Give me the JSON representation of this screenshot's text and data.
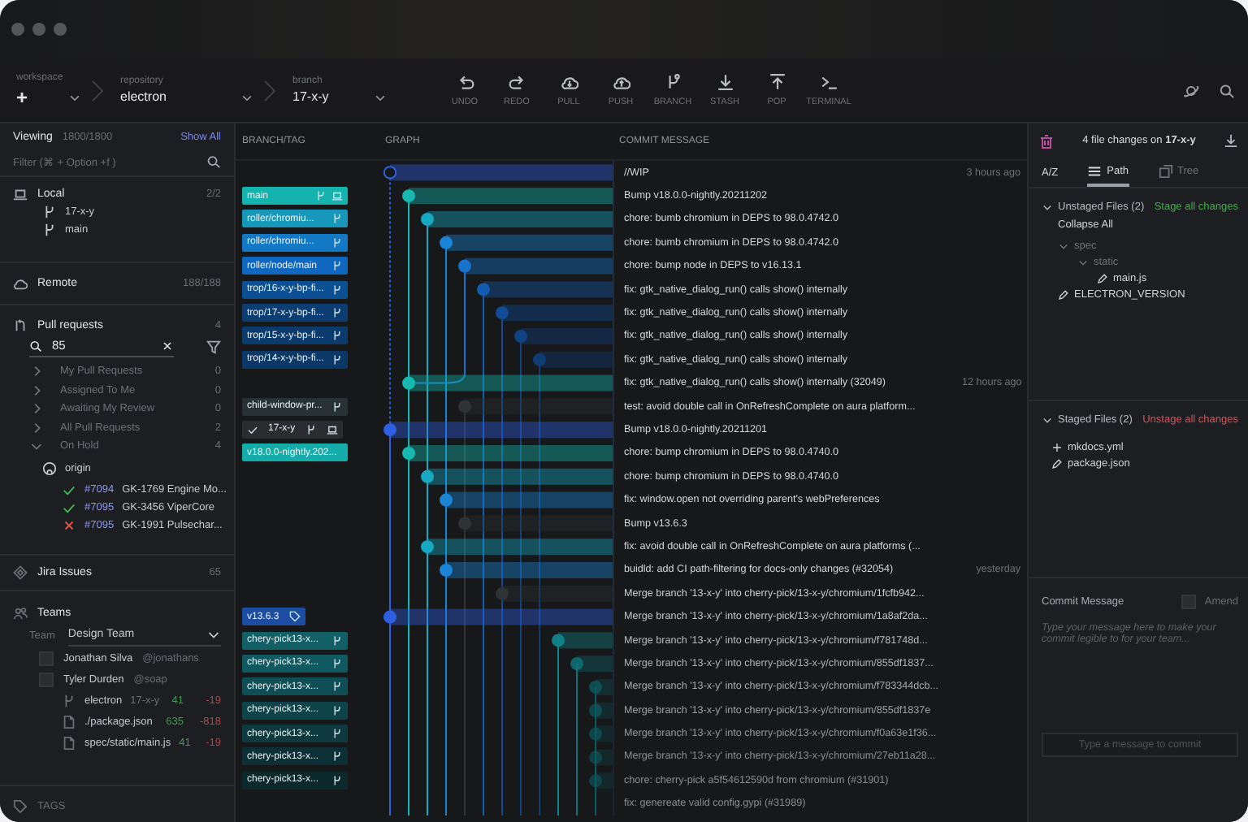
{
  "toolbar": {
    "workspace": {
      "label": "workspace",
      "value": "+"
    },
    "repository": {
      "label": "repository",
      "value": "electron"
    },
    "branch": {
      "label": "branch",
      "value": "17-x-y"
    },
    "actions": [
      {
        "label": "UNDO",
        "kind": "undo"
      },
      {
        "label": "REDO",
        "kind": "redo"
      },
      {
        "label": "PULL",
        "kind": "pull"
      },
      {
        "label": "PUSH",
        "kind": "push"
      },
      {
        "label": "BRANCH",
        "kind": "branch"
      },
      {
        "label": "STASH",
        "kind": "stash"
      },
      {
        "label": "POP",
        "kind": "pop"
      },
      {
        "label": "TERMINAL",
        "kind": "terminal"
      }
    ]
  },
  "sidebar": {
    "viewing": {
      "label": "Viewing",
      "count": "1800/1800",
      "action": "Show All"
    },
    "filter": {
      "placeholder": "Filter (⌘ + Option +f )"
    },
    "local": {
      "title": "Local",
      "count": "2/2",
      "branches": [
        "17-x-y",
        "main"
      ]
    },
    "remote": {
      "title": "Remote",
      "count": "188/188"
    },
    "pull_requests": {
      "title": "Pull requests",
      "count": "4",
      "search": {
        "value": "85"
      },
      "groups": [
        {
          "label": "My Pull Requests",
          "count": "0",
          "expanded": false
        },
        {
          "label": "Assigned To Me",
          "count": "0",
          "expanded": false
        },
        {
          "label": "Awaiting My Review",
          "count": "0",
          "expanded": false
        },
        {
          "label": "All Pull Requests",
          "count": "2",
          "expanded": false
        },
        {
          "label": "On Hold",
          "count": "4",
          "expanded": true
        }
      ],
      "remote": "origin",
      "items": [
        {
          "number": "#7094",
          "title": "GK-1769 Engine Mo...",
          "kind": "passed"
        },
        {
          "number": "#7095",
          "title": "GK-3456 ViperCore",
          "kind": "passed"
        },
        {
          "number": "#7095",
          "title": "GK-1991 Pulsechar...",
          "kind": "failed"
        }
      ]
    },
    "jira": {
      "title": "Jira Issues",
      "count": "65"
    },
    "teams": {
      "title": "Teams",
      "team_label": "Team",
      "team": "Design Team",
      "members": [
        {
          "name": "Jonathan Silva",
          "handle": "@jonathans",
          "checked": false
        },
        {
          "name": "Tyler Durden",
          "handle": "@soap",
          "checked": false
        }
      ],
      "files": [
        {
          "kind": "branch",
          "name": "electron",
          "branch": "17-x-y",
          "added": "41",
          "removed": "-19"
        },
        {
          "kind": "file",
          "name": "./package.json",
          "added": "635",
          "removed": "-818"
        },
        {
          "kind": "file",
          "name": "spec/static/main.js",
          "added": "41",
          "removed": "-19"
        }
      ]
    },
    "tags": {
      "title": "TAGS"
    }
  },
  "graph": {
    "columns": [
      "BRANCH/TAG",
      "GRAPH",
      "COMMIT MESSAGE"
    ],
    "rows": [
      {
        "message": "//WIP",
        "time": "3 hours ago"
      },
      {
        "message": "Bump v18.0.0-nightly.20211202",
        "ref": {
          "name": "main",
          "kind": "local-branch",
          "color": "#14b3ae"
        }
      },
      {
        "message": "chore: bumb chromium in DEPS to 98.0.4742.0",
        "ref": {
          "name": "roller/chromiu...",
          "kind": "branch",
          "color": "#1797b9"
        }
      },
      {
        "message": "chore: bumb chromium in DEPS to 98.0.4742.0",
        "ref": {
          "name": "roller/chromiu...",
          "kind": "branch",
          "color": "#1379c5"
        }
      },
      {
        "message": "chore: bump node in DEPS to v16.13.1",
        "ref": {
          "name": "roller/node/main",
          "kind": "branch",
          "color": "#0f67c0"
        }
      },
      {
        "message": "fix: gtk_native_dialog_run() calls show() internally",
        "ref": {
          "name": "trop/16-x-y-bp-fi...",
          "kind": "branch",
          "color": "#0c4f92"
        }
      },
      {
        "message": "fix: gtk_native_dialog_run() calls show() internally",
        "ref": {
          "name": "trop/17-x-y-bp-fi...",
          "kind": "branch",
          "color": "#0b3c72"
        }
      },
      {
        "message": "fix: gtk_native_dialog_run() calls show() internally",
        "ref": {
          "name": "trop/15-x-y-bp-fi...",
          "kind": "branch",
          "color": "#0b3a6c"
        }
      },
      {
        "message": "fix: gtk_native_dialog_run() calls show() internally",
        "ref": {
          "name": "trop/14-x-y-bp-fi...",
          "kind": "branch",
          "color": "#0b3866"
        }
      },
      {
        "message": "fix: gtk_native_dialog_run() calls show() internally (32049)",
        "time": "12 hours ago"
      },
      {
        "message": "test: avoid double call in OnRefreshComplete on aura platform...",
        "ref": {
          "name": "child-window-pr...",
          "kind": "branch",
          "color": "#283134"
        }
      },
      {
        "message": "Bump v18.0.0-nightly.20211201",
        "ref": {
          "name": "17-x-y",
          "kind": "head",
          "color": "#2a2c30"
        }
      },
      {
        "message": "chore: bump chromium in DEPS to 98.0.4740.0",
        "ref": {
          "name": "v18.0.0-nightly.202...",
          "kind": "plain",
          "color": "#14ada9"
        }
      },
      {
        "message": "chore: bump chromium in DEPS to 98.0.4740.0"
      },
      {
        "message": "fix: window.open not overriding parent's webPreferences"
      },
      {
        "message": "Bump v13.6.3"
      },
      {
        "message": "fix: avoid double call in OnRefreshComplete on aura platforms (..."
      },
      {
        "message": "buidld: add CI path-filtering for docs-only changes (#32054)",
        "time": "yesterday"
      },
      {
        "message": "Merge branch '13-x-y' into cherry-pick/13-x-y/chromium/1fcfb942..."
      },
      {
        "message": "Merge branch '13-x-y' into cherry-pick/13-x-y/chromium/1a8af2da...",
        "ref": {
          "name": "v13.6.3",
          "kind": "tag",
          "color": "#1c4da3"
        }
      },
      {
        "message": "Merge branch '13-x-y' into cherry-pick/13-x-y/chromium/f781748d...",
        "ref": {
          "name": "chery-pick13-x...",
          "kind": "branch",
          "color": "#125f66"
        }
      },
      {
        "message": "Merge branch '13-x-y' into cherry-pick/13-x-y/chromium/855df1837...",
        "ref": {
          "name": "chery-pick13-x...",
          "kind": "branch",
          "color": "#115960"
        }
      },
      {
        "message": "Merge branch '13-x-y' into cherry-pick/13-x-y/chromium/f783344dcb...",
        "ref": {
          "name": "chery-pick13-x...",
          "kind": "branch",
          "color": "#0f4e55"
        }
      },
      {
        "message": "Merge branch '13-x-y' into cherry-pick/13-x-y/chromium/855df1837e",
        "ref": {
          "name": "chery-pick13-x...",
          "kind": "branch",
          "color": "#0e434a"
        }
      },
      {
        "message": "Merge branch '13-x-y' into cherry-pick/13-x-y/chromium/f0a63e1f36...",
        "ref": {
          "name": "chery-pick13-x...",
          "kind": "branch",
          "color": "#0d393f"
        }
      },
      {
        "message": "Merge branch '13-x-y' into cherry-pick/13-x-y/chromium/27eb11a28...",
        "ref": {
          "name": "chery-pick13-x...",
          "kind": "branch",
          "color": "#0c3035"
        }
      },
      {
        "message": "chore: cherry-pick a5f54612590d from chromium (#31901)",
        "ref": {
          "name": "chery-pick13-x...",
          "kind": "branch",
          "color": "#0b282c"
        }
      },
      {
        "message": "fix: genereate valid config.gypi (#31989)"
      }
    ]
  },
  "panel": {
    "summary": "4 file changes on **17-x-y**",
    "sort": "A/Z",
    "views": [
      {
        "label": "Path",
        "kind": "path",
        "selected": true
      },
      {
        "label": "Tree",
        "kind": "tree",
        "selected": false
      }
    ],
    "unstaged": {
      "title": "Unstaged Files (2)",
      "action": "Stage all changes",
      "expanded": true,
      "collapse": "Collapse All",
      "tree": [
        {
          "name": "spec",
          "expanded": true,
          "children": [
            {
              "name": "static",
              "expanded": true,
              "children": [
                {
                  "name": "main.js",
                  "kind": "modified"
                }
              ]
            }
          ]
        },
        {
          "name": "ELECTRON_VERSION",
          "kind": "modified"
        }
      ]
    },
    "staged": {
      "title": "Staged Files (2)",
      "action": "Unstage all changes",
      "expanded": true,
      "files": [
        {
          "name": "mkdocs.yml",
          "kind": "added"
        },
        {
          "name": "package.json",
          "kind": "modified"
        }
      ]
    },
    "commit": {
      "title": "Commit Message",
      "amend": {
        "label": "Amend",
        "checked": false
      },
      "placeholder": "Type your message here to make your commit legible to for your team...",
      "button": "Type a message to commit"
    }
  }
}
